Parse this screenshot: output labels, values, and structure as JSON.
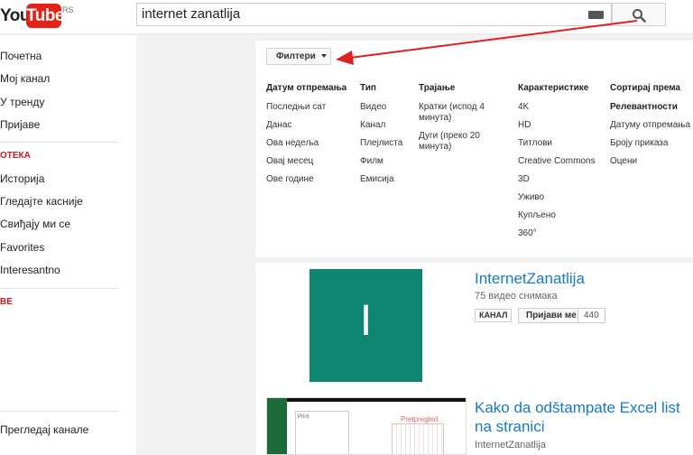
{
  "header": {
    "logo_you": "You",
    "logo_tube": "Tube",
    "logo_region": "RS",
    "search_value": "internet zanatlija"
  },
  "sidebar": {
    "items_top": [
      "Почетна",
      "Мој канал",
      "У тренду",
      "Пријаве"
    ],
    "section_library": "ОТЕКА",
    "items_library": [
      "Историја",
      "Гледајте касније",
      "Свиђају ми се",
      "Favorites",
      "Interesantno"
    ],
    "section_subs": "ВЕ",
    "item_bottom": "Прегледај канале"
  },
  "filters": {
    "button_label": "Филтери",
    "columns": [
      {
        "header": "Датум отпремања",
        "items": [
          "Последњи сат",
          "Данас",
          "Ова недеља",
          "Овај месец",
          "Ове године"
        ]
      },
      {
        "header": "Тип",
        "items": [
          "Видео",
          "Канал",
          "Плејлиста",
          "Филм",
          "Емисија"
        ]
      },
      {
        "header": "Трајање",
        "items": [
          "Кратки (испод 4 минута)",
          "Дуги (преко 20 минута)"
        ]
      },
      {
        "header": "Карактеристике",
        "items": [
          "4K",
          "HD",
          "Титлови",
          "Creative Commons",
          "3D",
          "Уживо",
          "Купљено",
          "360°"
        ]
      },
      {
        "header": "Сортирај према",
        "items": [
          "Релевантности",
          "Датуму отпремања",
          "Броју приказа",
          "Оцени"
        ]
      }
    ]
  },
  "results": {
    "channel": {
      "letter": "I",
      "title": "InternetZanatlija",
      "meta": "75 видео снимака",
      "badge": "КАНАЛ",
      "subscribe_label": "Пријави ме",
      "subscriber_count": "440"
    },
    "video": {
      "title": "Kako da odštampate Excel list na stranici",
      "channel": "InternetZanatlija",
      "thumb_print_label": "Print",
      "thumb_preview_label": "Pretpregled"
    }
  },
  "colors": {
    "accent_red": "#e62117",
    "link_blue": "#167ac6",
    "channel_green": "#0e8671",
    "annotation_arrow": "#e02020"
  }
}
